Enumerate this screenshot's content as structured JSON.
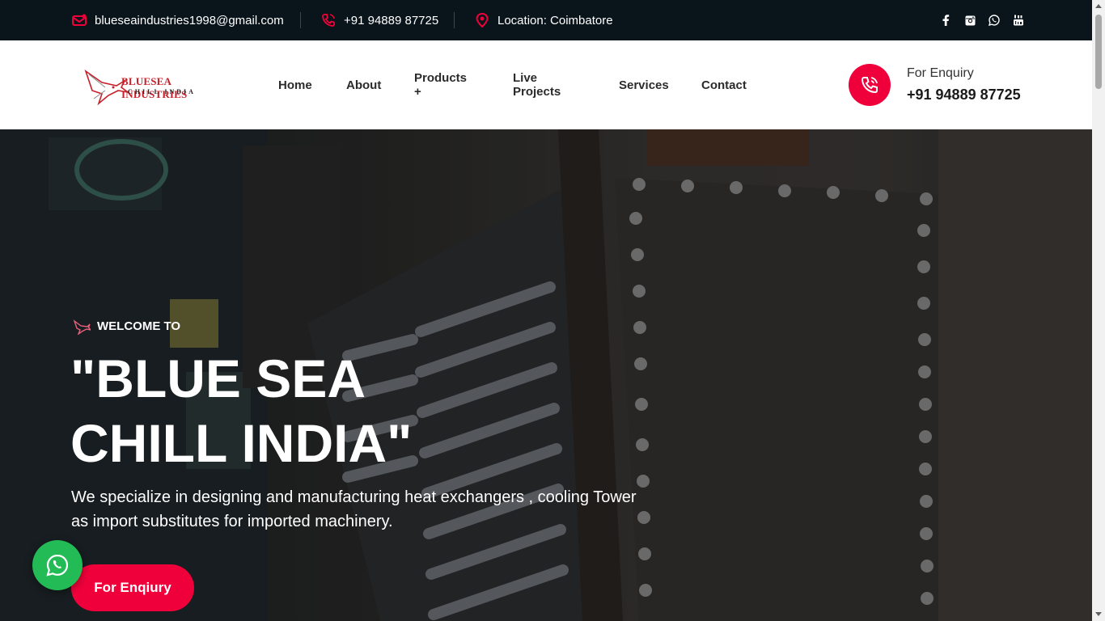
{
  "topbar": {
    "email": "blueseaindustries1998@gmail.com",
    "phone": "+91 94889 87725",
    "location": "Location: Coimbatore",
    "icons": [
      "email-icon",
      "phone-icon",
      "location-icon"
    ],
    "social": [
      "facebook-icon",
      "instagram-icon",
      "whatsapp-icon",
      "youtube-icon"
    ]
  },
  "logo": {
    "title": "BLUESEA INDUSTRIES",
    "subtitle": "CHILL INDIA"
  },
  "nav": {
    "items": [
      {
        "label": "Home"
      },
      {
        "label": "About"
      },
      {
        "label": "Products +"
      },
      {
        "label": "Live Projects"
      },
      {
        "label": "Services"
      },
      {
        "label": "Contact"
      }
    ]
  },
  "enquiry": {
    "label": "For Enquiry",
    "phone": "+91 94889 87725"
  },
  "hero": {
    "welcome": "WELCOME TO",
    "title_line1": "\"BLUE SEA",
    "title_line2": "CHILL INDIA\"",
    "description": "We specialize in designing and manufacturing heat exchangers , cooling Tower as import substitutes for imported machinery.",
    "button": "For Enqiury"
  },
  "colors": {
    "accent": "#f0003a",
    "topbar_bg": "#0a141b",
    "whatsapp": "#22bb55"
  }
}
